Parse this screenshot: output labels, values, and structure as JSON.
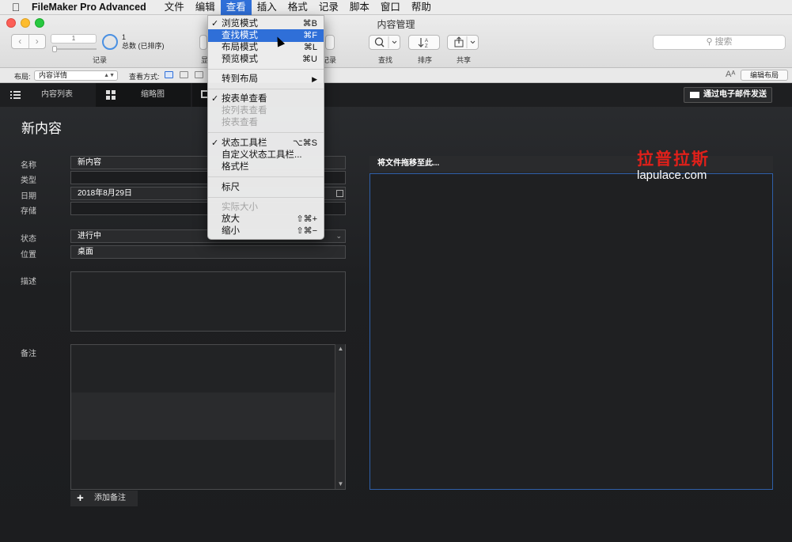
{
  "menubar": {
    "apple": "",
    "app": "FileMaker Pro Advanced",
    "items": [
      "文件",
      "编辑",
      "查看",
      "插入",
      "格式",
      "记录",
      "脚本",
      "窗口",
      "帮助"
    ]
  },
  "window": {
    "title": "内容管理"
  },
  "toolbar": {
    "record_value": "1",
    "record_count": "1",
    "record_status": "总数 (已排序)",
    "records_label": "记录",
    "partial_label_left": "显",
    "partial_label_right": "记录",
    "find_label": "查找",
    "sort_label": "排序",
    "share_label": "共享",
    "search_placeholder": "搜索"
  },
  "layoutbar": {
    "layout_label": "布局:",
    "layout_value": "内容详情",
    "view_label": "查看方式:",
    "edit_layout": "编辑布局",
    "aa": "Aᴬ"
  },
  "tabs": {
    "list": "内容列表",
    "thumbs": "缩略图",
    "email": "通过电子邮件发送"
  },
  "form": {
    "title": "新内容",
    "name_label": "名称",
    "name_value": "新内容",
    "type_label": "类型",
    "date_label": "日期",
    "date_value": "2018年8月29日",
    "storage_label": "存储",
    "status_label": "状态",
    "status_value": "进行中",
    "location_label": "位置",
    "location_value": "桌面",
    "desc_label": "描述",
    "notes_label": "备注",
    "add_note": "添加备注",
    "drop_label": "将文件拖移至此..."
  },
  "watermark": {
    "cn": "拉普拉斯",
    "en": "lapulace.com"
  },
  "view_menu": [
    {
      "label": "浏览模式",
      "shortcut": "⌘B",
      "checked": true
    },
    {
      "label": "查找模式",
      "shortcut": "⌘F",
      "highlighted": true
    },
    {
      "label": "布局模式",
      "shortcut": "⌘L"
    },
    {
      "label": "预览模式",
      "shortcut": "⌘U"
    },
    {
      "label": "转到布局",
      "submenu": "▶"
    },
    {
      "label": "按表单查看",
      "checked": true
    },
    {
      "label": "按列表查看",
      "disabled": true
    },
    {
      "label": "按表查看",
      "disabled": true
    },
    {
      "label": "状态工具栏",
      "shortcut": "⌥⌘S",
      "checked": true
    },
    {
      "label": "自定义状态工具栏...",
      "shortcut": ""
    },
    {
      "label": "格式栏",
      "shortcut": ""
    },
    {
      "label": "标尺",
      "shortcut": ""
    },
    {
      "label": "实际大小",
      "disabled": true
    },
    {
      "label": "放大",
      "shortcut": "⇧⌘+"
    },
    {
      "label": "缩小",
      "shortcut": "⇧⌘−"
    }
  ],
  "check_glyph": "✓",
  "colors": {
    "accent": "#2f6fd8",
    "watermark_red": "#e0201a"
  }
}
